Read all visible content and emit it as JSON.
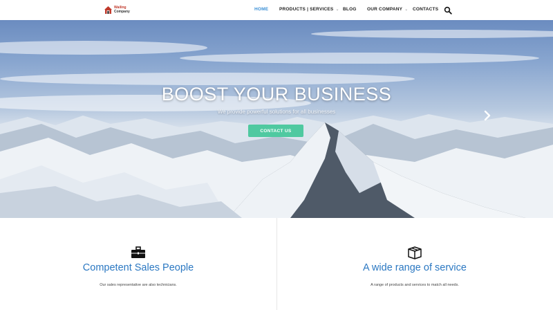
{
  "header": {
    "logo": {
      "brand": "Wailing",
      "company": "Company"
    },
    "nav": [
      {
        "label": "HOME",
        "active": true
      },
      {
        "label": "PRODUCTS | SERVICES",
        "dropdown": true
      },
      {
        "label": "BLOG"
      },
      {
        "label": "OUR COMPANY",
        "dropdown": true
      },
      {
        "label": "CONTACTS"
      }
    ],
    "search_icon": "search-icon"
  },
  "hero": {
    "title": "BOOST YOUR BUSINESS",
    "subtitle": "We provide powerful solutions for all businesses",
    "cta_label": "CONTACT US",
    "next_icon": "chevron-right-icon"
  },
  "features": [
    {
      "icon": "briefcase-icon",
      "title": "Competent Sales People",
      "text": "Our sales representative are also technicians."
    },
    {
      "icon": "box-icon",
      "title": "A wide range of service",
      "text": "A range of products and services to match all needs."
    }
  ],
  "colors": {
    "accent": "#3a8fd6",
    "cta": "#4fc9a0",
    "feature_title": "#2b78c2"
  }
}
